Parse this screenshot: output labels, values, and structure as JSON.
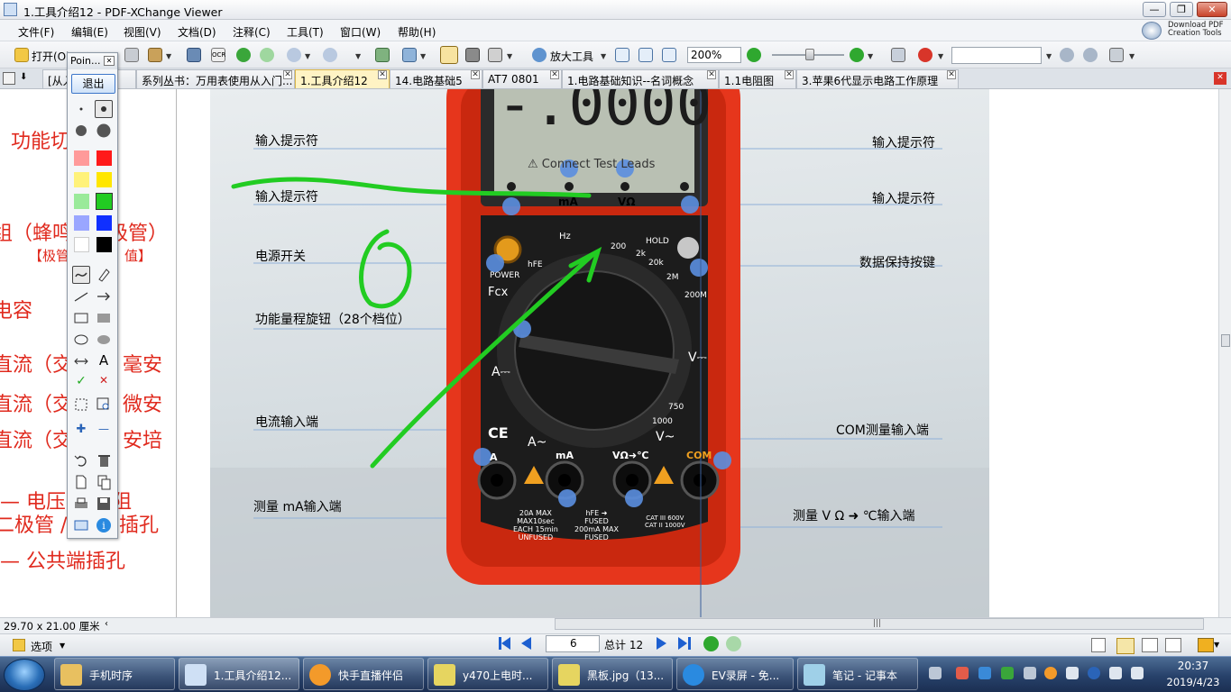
{
  "window": {
    "title": "1.工具介绍12 - PDF-XChange Viewer",
    "download_pdf_line1": "Download PDF",
    "download_pdf_line2": "Creation Tools",
    "minimize": "—",
    "maximize": "❐",
    "close": "✕"
  },
  "menu": [
    "文件(F)",
    "编辑(E)",
    "视图(V)",
    "文档(D)",
    "注释(C)",
    "工具(T)",
    "窗口(W)",
    "帮助(H)"
  ],
  "toolbar": {
    "open_label": "打开(O)",
    "ocr_label": "OCR",
    "zoom_tool_label": "放大工具",
    "zoom_value": "200%"
  },
  "tabs": [
    {
      "label": "[从入",
      "active": false
    },
    {
      "label": "系列丛书：万用表使用从入门...",
      "active": false
    },
    {
      "label": "1.工具介绍12",
      "active": true
    },
    {
      "label": "14.电路基础5",
      "active": false
    },
    {
      "label": "AT7 0801",
      "active": false
    },
    {
      "label": "1.电路基础知识--名词概念",
      "active": false
    },
    {
      "label": "1.1电阻图",
      "active": false
    },
    {
      "label": "3.苹果6代显示电路工作原理",
      "active": false
    }
  ],
  "palette": {
    "title": "Poin...",
    "exit_label": "退出",
    "colors": [
      "#ff9a9a",
      "#ff1a1a",
      "#fff27a",
      "#ffe600",
      "#9aea9a",
      "#22cc22",
      "#9aa6ff",
      "#1030ff",
      "#ffffff",
      "#000000"
    ],
    "text_tool": "A",
    "check": "✓",
    "cross": "✕",
    "plus": "✚",
    "minus": "—"
  },
  "left_page": {
    "l1": "功能切",
    "l2": "组（蜂鸣",
    "l2b": "极管）",
    "l3": "【极管",
    "l3b": "值】",
    "l4": "电容",
    "l5": "直流（交",
    "l5b": "毫安",
    "l6": "直流（交",
    "l6b": "微安",
    "l7": "直流（交",
    "l7b": "安培",
    "l8": "— 电压",
    "l8b": "阻",
    "l9": "二极管 /",
    "l9b": "插孔",
    "l10": "— 公共端插孔"
  },
  "diagram": {
    "label_input_hint_1": "输入提示符",
    "label_input_hint_2": "输入提示符",
    "label_input_hint_3": "输入提示符",
    "label_input_hint_4": "输入提示符",
    "label_power": "电源开关",
    "label_dial": "功能量程旋钮（28个档位）",
    "label_current_input": "电流输入端",
    "label_ma_input": "测量 mA输入端",
    "label_hold": "数据保持按键",
    "label_com": "COM测量输入端",
    "label_v_input": "测量 V Ω ➜ ℃输入端",
    "lcd_reading": "-.0000",
    "lcd_hint": "⚠ Connect Test Leads",
    "jack_ma": "mA",
    "jack_vo": "VΩ",
    "btn_power": "POWER",
    "btn_hold": "HOLD",
    "dial_hz": "Hz",
    "dial_hfe": "hFE",
    "dial_fcx": "Fcx",
    "dial_200": "200",
    "dial_2k": "2k",
    "dial_20k": "20k",
    "dial_2m": "2M",
    "dial_200m": "200M",
    "dial_1000": "1000",
    "dial_750": "750",
    "dial_ce": "CE",
    "dial_a_dc": "A⎓",
    "dial_a_ac": "A~",
    "dial_v_ac": "V~",
    "dial_v_dc": "V⎓",
    "jack_a": "A",
    "jack_ma2": "mA",
    "jack_vo2": "VΩ➜℃",
    "jack_com": "COM",
    "fuse_1": "20A MAX",
    "fuse_2": "MAX10sec",
    "fuse_3": "EACH 15min",
    "fuse_4": "UNFUSED",
    "fuse_5": "hFE ➜",
    "fuse_6": "FUSED",
    "fuse_7": "200mA MAX",
    "fuse_8": "FUSED",
    "fuse_9": "CAT III 600V",
    "fuse_10": "CAT II 1000V",
    "annotation_color": "#22cc22"
  },
  "status": {
    "dimensions": "29.70 x 21.00 厘米",
    "options_label": "选项"
  },
  "nav": {
    "page_value": "6",
    "total_label": "总计 12"
  },
  "taskbar": {
    "items": [
      "手机时序",
      "1.工具介绍12...",
      "快手直播伴侣",
      "y470上电时...",
      "黑板.jpg（13...",
      "EV录屏 - 免...",
      "笔记 - 记事本"
    ],
    "time": "20:37",
    "date": "2019/4/23"
  }
}
